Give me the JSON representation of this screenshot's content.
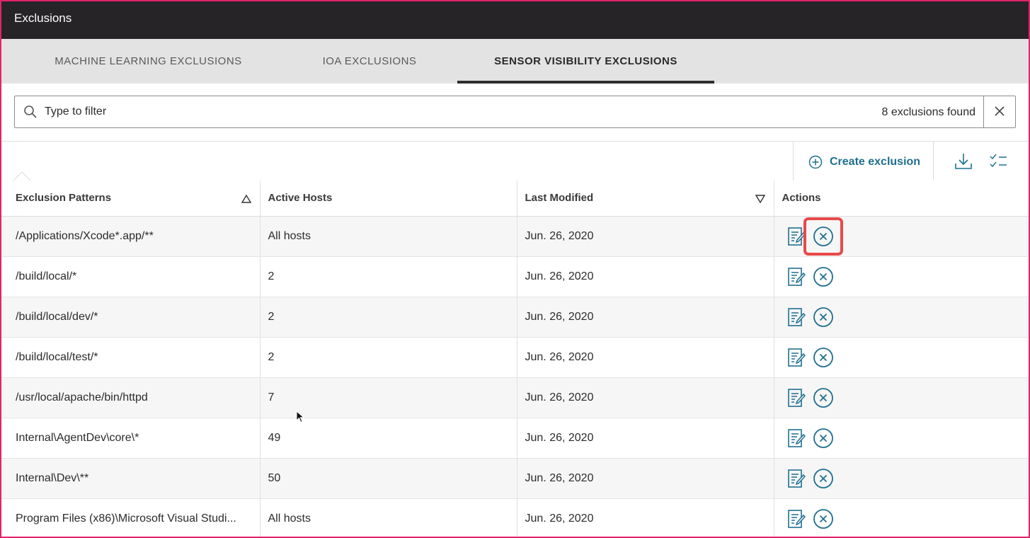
{
  "window": {
    "title": "Exclusions"
  },
  "tabs": [
    {
      "label": "MACHINE LEARNING EXCLUSIONS",
      "active": false
    },
    {
      "label": "IOA EXCLUSIONS",
      "active": false
    },
    {
      "label": "SENSOR VISIBILITY EXCLUSIONS",
      "active": true
    }
  ],
  "filter": {
    "placeholder": "Type to filter",
    "value": "",
    "results_count": "8 exclusions found"
  },
  "toolbar": {
    "create_label": "Create exclusion",
    "icons": [
      "plus-circle-icon",
      "download-icon",
      "checklist-icon"
    ]
  },
  "table": {
    "columns": [
      "Exclusion Patterns",
      "Active Hosts",
      "Last Modified",
      "Actions"
    ],
    "sort": {
      "Exclusion Patterns": "ascending",
      "Last Modified": "descending"
    },
    "rows": [
      {
        "pattern": "/Applications/Xcode*.app/**",
        "hosts": "All hosts",
        "modified": "Jun. 26, 2020"
      },
      {
        "pattern": "/build/local/*",
        "hosts": "2",
        "modified": "Jun. 26, 2020"
      },
      {
        "pattern": "/build/local/dev/*",
        "hosts": "2",
        "modified": "Jun. 26, 2020"
      },
      {
        "pattern": "/build/local/test/*",
        "hosts": "2",
        "modified": "Jun. 26, 2020"
      },
      {
        "pattern": "/usr/local/apache/bin/httpd",
        "hosts": "7",
        "modified": "Jun. 26, 2020"
      },
      {
        "pattern": "Internal\\AgentDev\\core\\*",
        "hosts": "49",
        "modified": "Jun. 26, 2020"
      },
      {
        "pattern": "Internal\\Dev\\**",
        "hosts": "50",
        "modified": "Jun. 26, 2020"
      },
      {
        "pattern": "Program Files (x86)\\Microsoft Visual Studi...",
        "hosts": "All hosts",
        "modified": "Jun. 26, 2020"
      }
    ],
    "row_actions": [
      "edit-icon",
      "delete-icon"
    ]
  },
  "colors": {
    "titlebar": "#262426",
    "tabbar": "#e3e3e3",
    "accent": "#1f6f8f",
    "highlight": "#e84949",
    "frame": "#e0256a"
  }
}
